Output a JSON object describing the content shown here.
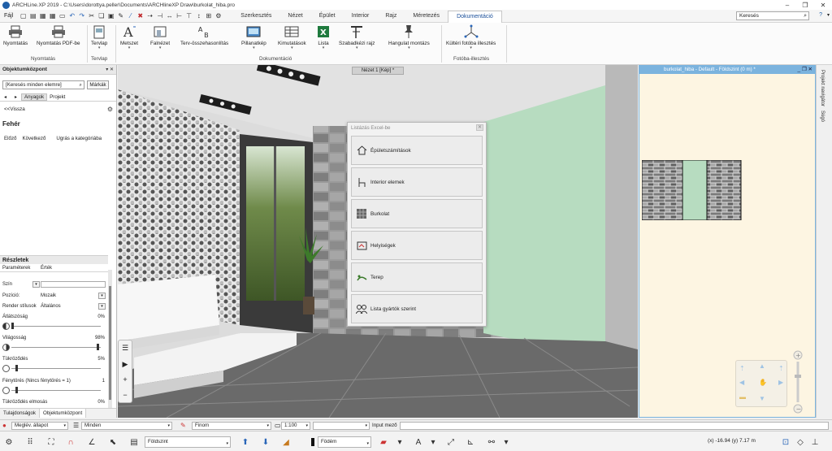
{
  "window": {
    "title": "ARCHLine.XP 2019 - C:\\Users\\dorottya.peller\\Documents\\ARCHlineXP Draw\\burkolat_hiba.pro"
  },
  "menu": {
    "file": "Fájl",
    "tabs": [
      {
        "label": "Szerkesztés",
        "active": false
      },
      {
        "label": "Nézet",
        "active": false
      },
      {
        "label": "Épület",
        "active": false
      },
      {
        "label": "Interior",
        "active": false
      },
      {
        "label": "Rajz",
        "active": false
      },
      {
        "label": "Méretezés",
        "active": false
      },
      {
        "label": "Dokumentáció",
        "active": true
      }
    ],
    "search_placeholder": "Keresés"
  },
  "ribbon": {
    "buttons": {
      "print": "Nyomtatás",
      "print_pdf": "Nyomtatás PDF-be",
      "plan": "Tervlap",
      "section": "Metszet",
      "elevation": "Falnézet",
      "compare": "Terv-összehasonlítás",
      "snapshot": "Pillanatkép",
      "reports": "Kimutatások",
      "list": "Lista",
      "freehand": "Szabadkézi rajz",
      "mood": "Hangulat montázs",
      "photo_match": "Kültéri fotóba illesztés"
    },
    "groups": {
      "printing": "Nyomtatás",
      "plan": "Tervlap",
      "documentation": "Dokumentáció",
      "photo_match": "Fotóba-illesztés"
    }
  },
  "object_center": {
    "title": "Objektumközpont",
    "search_placeholder": "[Keresés minden elemre]",
    "mark_button": "Márkák",
    "tabs": [
      "Anyagok",
      "Projekt"
    ],
    "back": "<<Vissza",
    "material_name": "Fehér",
    "nav": [
      "Előző",
      "Következő",
      "Ugrás a kategóriába"
    ]
  },
  "details": {
    "title": "Részletek",
    "col_param": "Paraméterek",
    "col_value": "Érték",
    "color_label": "Szín",
    "position_label": "Pozíció:",
    "position_value": "Mozaik",
    "render_label": "Render stílusok",
    "render_value": "Általános",
    "transparency_label": "Átlátszóság",
    "transparency_value": "0%",
    "transparency_level": 0,
    "brightness_label": "Világosság",
    "brightness_value": "98%",
    "brightness_level": 0.98,
    "reflection_label": "Tükröződés",
    "reflection_value": "5%",
    "reflection_level": 0.05,
    "refraction_label": "Fénytörés (Nincs fénytörés = 1)",
    "refraction_value": "1",
    "refraction_level": 0.05,
    "blur_label": "Tükröződés elmosás",
    "blur_value": "0%"
  },
  "panel_tabs": [
    "Tulajdonságok",
    "Objektumközpont"
  ],
  "viewport": {
    "tab_label": "Nézet 1 [Kép] *"
  },
  "dialog": {
    "title": "Listázás Excel-be",
    "items": [
      {
        "label": "Épületszámítások",
        "icon": "house-icon"
      },
      {
        "label": "Interior elemek",
        "icon": "chair-icon"
      },
      {
        "label": "Burkolat",
        "icon": "tiles-icon"
      },
      {
        "label": "Helyiségek",
        "icon": "room-icon"
      },
      {
        "label": "Terep",
        "icon": "terrain-icon"
      },
      {
        "label": "Lista gyártók szerint",
        "icon": "people-icon"
      }
    ]
  },
  "planview": {
    "title": "burkolat_hiba - Default - Földszint (0 m) *"
  },
  "side_tabs": [
    "Projekt navigátor",
    "Súgó"
  ],
  "statusbar": {
    "state_label": "Meglév. állapot",
    "filter_value": "Minden",
    "line_label": "Finom",
    "scale_value": "1:100",
    "input_label": "Input mező",
    "floor_value": "Földszint",
    "layer_value": "Födém",
    "coords": "(x) -16.94  (y) 7.17 m"
  },
  "colors": {
    "accent": "#7bb3de",
    "green_wall": "#b7dcc0",
    "plan_bg": "#fdf5e2"
  }
}
